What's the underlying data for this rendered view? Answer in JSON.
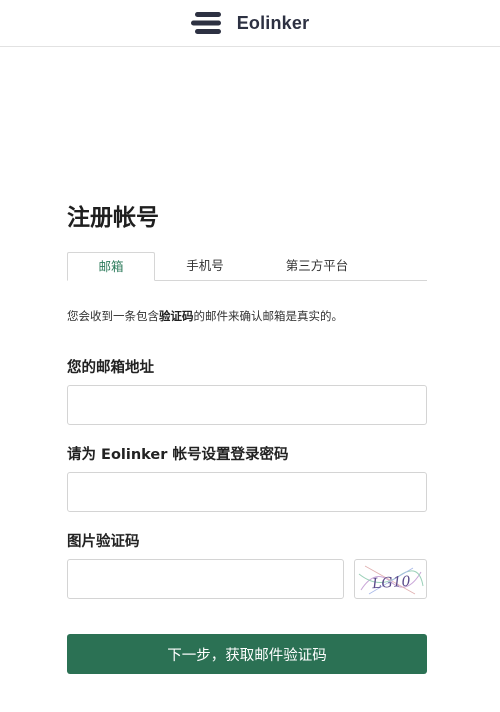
{
  "header": {
    "brand_name": "Eolinker",
    "logo_icon": "eolinker-logo-icon"
  },
  "form": {
    "title": "注册帐号",
    "tabs": [
      {
        "label": "邮箱",
        "active": true
      },
      {
        "label": "手机号",
        "active": false
      },
      {
        "label": "第三方平台",
        "active": false
      }
    ],
    "notice": {
      "before": "您会收到一条包含",
      "highlight": "验证码",
      "after": "的邮件来确认邮箱是真实的。"
    },
    "email_label": "您的邮箱地址",
    "email_value": "",
    "password_label": "请为 Eolinker 帐号设置登录密码",
    "password_value": "",
    "captcha_label": "图片验证码",
    "captcha_value": "",
    "captcha_text": "LG10",
    "submit_label": "下一步，获取邮件验证码"
  },
  "colors": {
    "primary": "#2b7154",
    "active_tab_text": "#2b7a5a",
    "border": "#d4d4d4"
  }
}
